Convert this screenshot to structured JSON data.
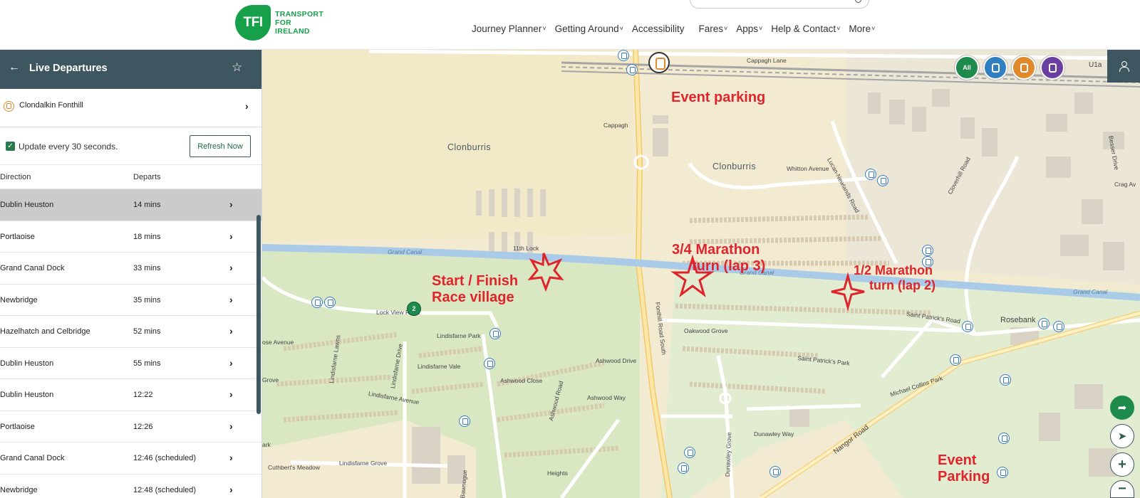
{
  "header": {
    "logo_badge": "TFI",
    "logo_line1": "TRANSPORT",
    "logo_line2": "FOR",
    "logo_line3": "IRELAND",
    "nav": [
      {
        "label": "Journey Planner",
        "chevron": true
      },
      {
        "label": "Getting Around",
        "chevron": true
      },
      {
        "label": "Accessibility",
        "chevron": false
      },
      {
        "label": "Fares",
        "chevron": true
      },
      {
        "label": "Apps",
        "chevron": true
      },
      {
        "label": "Help & Contact",
        "chevron": true
      },
      {
        "label": "More",
        "chevron": true
      }
    ]
  },
  "sidebar": {
    "title": "Live Departures",
    "stop_name": "Clondalkin Fonthill",
    "update_label": "Update every 30 seconds.",
    "update_checked": true,
    "refresh_label": "Refresh Now",
    "col_direction": "Direction",
    "col_departs": "Departs",
    "departures": [
      {
        "direction": "Dublin Heuston",
        "departs": "14 mins",
        "selected": true
      },
      {
        "direction": "Portlaoise",
        "departs": "18 mins"
      },
      {
        "direction": "Grand Canal Dock",
        "departs": "33 mins"
      },
      {
        "direction": "Newbridge",
        "departs": "35 mins"
      },
      {
        "direction": "Hazelhatch and Celbridge",
        "departs": "52 mins"
      },
      {
        "direction": "Dublin Heuston",
        "departs": "55 mins"
      },
      {
        "direction": "Dublin Heuston",
        "departs": "12:22"
      },
      {
        "direction": "Portlaoise",
        "departs": "12:26"
      },
      {
        "direction": "Grand Canal Dock",
        "departs": "12:46 (scheduled)"
      },
      {
        "direction": "Newbridge",
        "departs": "12:48 (scheduled)"
      }
    ]
  },
  "map": {
    "filters": [
      {
        "label": "All",
        "color": "#1e8a4c"
      },
      {
        "label": "",
        "icon": "bus-icon",
        "color": "#2f7fc1"
      },
      {
        "label": "",
        "icon": "train-icon",
        "color": "#e0892a"
      },
      {
        "label": "",
        "icon": "tram-icon",
        "color": "#6b3fa0"
      }
    ],
    "places": {
      "clonburris_west": "Clonburris",
      "clonburris_east": "Clonburris",
      "cappagh": "Cappagh",
      "rosebank": "Rosebank",
      "grand_canal_1": "Grand Canal",
      "grand_canal_2": "Grand Canal",
      "grand_canal_3": "Grand Canal",
      "eleventh_lock": "11th Lock"
    },
    "streets": {
      "cappagh_lane": "Cappagh Lane",
      "u1a": "U1a",
      "whitton": "Whitton Avenue",
      "lucan_newlands": "Lucan-Newlands Road",
      "cloverhill": "Cloverhill Road",
      "besser": "Besser Drive",
      "crag": "Crag Av",
      "lock_view": "Lock View Road",
      "lindisfarne_park": "Lindisfarne Park",
      "lindisfarne_drive": "Lindisfarne Drive",
      "lindisfarne_vale": "Lindisfarne Vale",
      "lindisfarne_avenue": "Lindisfarne Avenue",
      "lindisfarne_lawns": "Lindisfarne Lawns",
      "lindisfarne_grove": "Lindisfarne Grove",
      "ashwood_drive": "Ashwood Drive",
      "ashwood_close": "Ashwood Close",
      "ashwood_road": "Ashwood Road",
      "ashwood_way": "Ashwood Way",
      "fonthill_south": "Fonthill Road South",
      "st_patricks_road": "Saint Patrick's Road",
      "st_patricks_park": "Saint Patrick's Park",
      "oakwood": "Oakwood Grove",
      "michael_collins": "Michael Collins Park",
      "nangor": "Nangor Road",
      "dunawley_way": "Dunawley Way",
      "dunawley_grove": "Dunawley Grove",
      "cuthberts": "Cuthbert's Meadow",
      "bawnogue": "Bawnogue",
      "heights": "Heights",
      "rose_avenue": "ose Avenue",
      "grove": "Grove",
      "ark": "ark"
    },
    "annotations": {
      "event_parking_top": "Event parking",
      "start_finish_1": "Start / Finish",
      "start_finish_2": "Race village",
      "three_quarter_1": "3/4 Marathon",
      "three_quarter_2": "turn (lap 3)",
      "half_1": "1/2 Marathon",
      "half_2": "turn (lap 2)",
      "event_parking_bottom_1": "Event",
      "event_parking_bottom_2": "Parking"
    },
    "annotation_color": "#e0242c",
    "cluster_count": "2"
  }
}
